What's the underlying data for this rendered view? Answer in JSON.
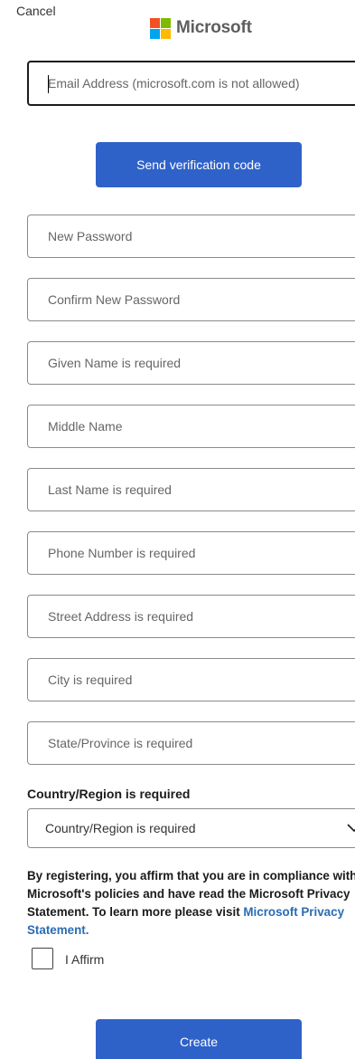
{
  "header": {
    "cancel_label": "Cancel",
    "logo_text": "Microsoft",
    "logo_colors": [
      "#f25022",
      "#7fba00",
      "#00a4ef",
      "#ffb900"
    ]
  },
  "email": {
    "placeholder": "Email Address (microsoft.com is not allowed)",
    "value": ""
  },
  "send_button_label": "Send verification code",
  "fields": [
    {
      "placeholder": "New Password"
    },
    {
      "placeholder": "Confirm New Password"
    },
    {
      "placeholder": "Given Name is required"
    },
    {
      "placeholder": "Middle Name"
    },
    {
      "placeholder": "Last Name is required"
    },
    {
      "placeholder": "Phone Number is required"
    },
    {
      "placeholder": "Street Address is required"
    },
    {
      "placeholder": "City is required"
    },
    {
      "placeholder": "State/Province is required"
    }
  ],
  "country": {
    "label": "Country/Region is required",
    "selected": "Country/Region is required",
    "icon": "chevron-down-icon"
  },
  "consent": {
    "text": "By registering, you affirm that you are in compliance with Microsoft's policies and have read the Microsoft Privacy Statement. To learn more please visit ",
    "link": "Microsoft Privacy Statement."
  },
  "affirm": {
    "label": "I Affirm",
    "checked": false
  },
  "create_button_label": "Create",
  "colors": {
    "primary": "#2f62c9",
    "link": "#2a6cb3"
  }
}
